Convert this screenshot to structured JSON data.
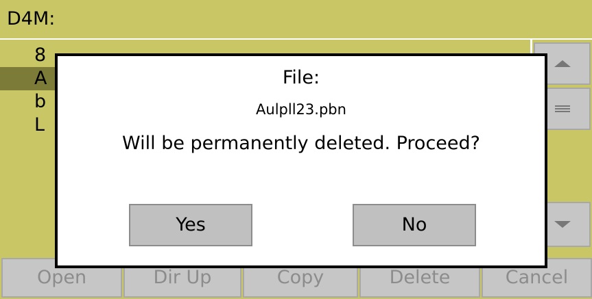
{
  "title": "D4M:",
  "files": [
    "8",
    "A",
    "b",
    "L"
  ],
  "selected_index": 1,
  "toolbar": {
    "open": "Open",
    "dir_up": "Dir Up",
    "copy": "Copy",
    "delete": "Delete",
    "cancel": "Cancel"
  },
  "dialog": {
    "title": "File:",
    "filename": "Aulpll23.pbn",
    "message": "Will be permanently deleted. Proceed?",
    "yes": "Yes",
    "no": "No"
  },
  "colors": {
    "background": "#c9c666",
    "selection": "#7d7b38",
    "button": "#c6c6c6",
    "disabled_text": "#8c8c8c"
  }
}
